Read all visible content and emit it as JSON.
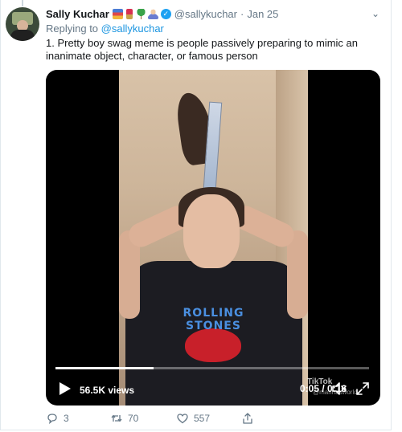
{
  "tweet": {
    "author_name": "Sally Kuchar",
    "emoji_icons": [
      "books-icon",
      "lipstick-icon",
      "palm-tree-icon",
      "woman-icon"
    ],
    "handle": "@sallykuchar",
    "separator": "·",
    "date": "Jan 25",
    "caret": "⌄",
    "replying_prefix": "Replying to ",
    "replying_to": "@sallykuchar",
    "text": "1. Pretty boy swag meme is people passively preparing to mimic an inanimate object, character, or famous person"
  },
  "video": {
    "views": "56.5K views",
    "time": "0:05 / 0:16",
    "progress": 0.3125,
    "watermark_brand": "TikTok",
    "watermark_user": "@marinasworld",
    "shirt_text": "ROLLING STONES"
  },
  "actions": {
    "reply_count": "3",
    "retweet_count": "70",
    "like_count": "557"
  },
  "colors": {
    "accent": "#1da1f2",
    "link": "#1b95e0",
    "muted": "#657786"
  }
}
